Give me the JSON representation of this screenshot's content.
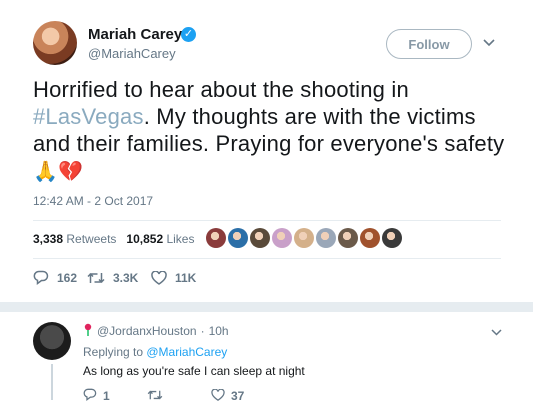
{
  "tweet": {
    "author_name": "Mariah Carey",
    "author_handle": "@MariahCarey",
    "verified_icon": "verified-badge-icon",
    "follow_label": "Follow",
    "text_before": "Horrified to hear about the shooting in ",
    "hashtag": "#LasVegas",
    "text_after": ". My thoughts are with the victims and their families. Praying for everyone's safety ",
    "emojis": "🙏💔",
    "timestamp": "12:42 AM - 2 Oct 2017",
    "retweets_count": "3,338",
    "retweets_label": "Retweets",
    "likes_count": "10,852",
    "likes_label": "Likes",
    "liker_colors": [
      "#8a3b3b",
      "#2b6fa8",
      "#5a4a3a",
      "#c9a0c9",
      "#d4b08a",
      "#9aa7b8",
      "#6b5a4a",
      "#a0522d",
      "#3a3a3a"
    ],
    "actions": {
      "reply": "162",
      "retweet": "3.3K",
      "like": "11K"
    }
  },
  "reply": {
    "flag_icon": "rose-icon",
    "handle": "@JordanxHouston",
    "separator": "·",
    "time": "10h",
    "replying_to_label": "Replying to ",
    "replying_to_handle": "@MariahCarey",
    "text": "As long as you're safe I can sleep at night",
    "actions": {
      "reply": "1",
      "retweet": "",
      "like": "37"
    }
  },
  "colors": {
    "accent": "#1da1f2",
    "muted": "#657786",
    "hashtag": "#8aaabf",
    "heart_emoji": "#e0245e"
  }
}
